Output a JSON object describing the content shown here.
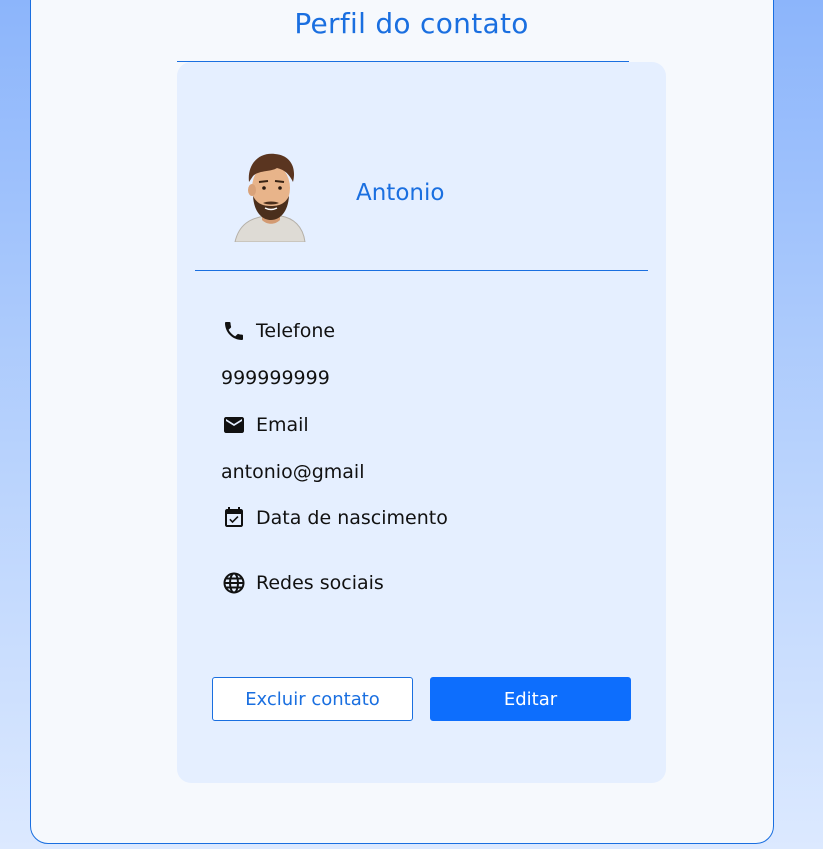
{
  "header": {
    "title": "Perfil do contato"
  },
  "contact": {
    "name": "Antonio",
    "phone_label": "Telefone",
    "phone_value": "999999999",
    "email_label": "Email",
    "email_value": "antonio@gmail",
    "birth_label": "Data de nascimento",
    "social_label": "Redes sociais"
  },
  "actions": {
    "delete_label": "Excluir contato",
    "edit_label": "Editar"
  },
  "colors": {
    "accent": "#1a6fe0",
    "primary_button": "#0d6efd",
    "card": "#e5efff"
  },
  "icons": [
    "avatar",
    "phone-icon",
    "mail-icon",
    "calendar-check-icon",
    "globe-icon"
  ]
}
